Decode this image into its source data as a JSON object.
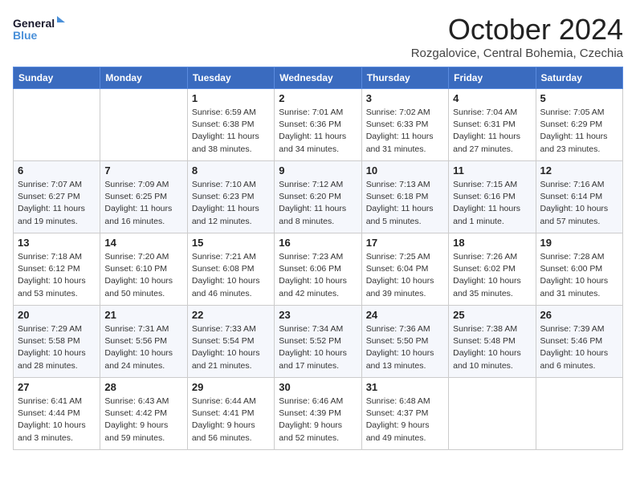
{
  "header": {
    "logo_general": "General",
    "logo_blue": "Blue",
    "month": "October 2024",
    "location": "Rozgalovice, Central Bohemia, Czechia"
  },
  "days_of_week": [
    "Sunday",
    "Monday",
    "Tuesday",
    "Wednesday",
    "Thursday",
    "Friday",
    "Saturday"
  ],
  "weeks": [
    [
      {
        "day": "",
        "info": ""
      },
      {
        "day": "",
        "info": ""
      },
      {
        "day": "1",
        "info": "Sunrise: 6:59 AM\nSunset: 6:38 PM\nDaylight: 11 hours and 38 minutes."
      },
      {
        "day": "2",
        "info": "Sunrise: 7:01 AM\nSunset: 6:36 PM\nDaylight: 11 hours and 34 minutes."
      },
      {
        "day": "3",
        "info": "Sunrise: 7:02 AM\nSunset: 6:33 PM\nDaylight: 11 hours and 31 minutes."
      },
      {
        "day": "4",
        "info": "Sunrise: 7:04 AM\nSunset: 6:31 PM\nDaylight: 11 hours and 27 minutes."
      },
      {
        "day": "5",
        "info": "Sunrise: 7:05 AM\nSunset: 6:29 PM\nDaylight: 11 hours and 23 minutes."
      }
    ],
    [
      {
        "day": "6",
        "info": "Sunrise: 7:07 AM\nSunset: 6:27 PM\nDaylight: 11 hours and 19 minutes."
      },
      {
        "day": "7",
        "info": "Sunrise: 7:09 AM\nSunset: 6:25 PM\nDaylight: 11 hours and 16 minutes."
      },
      {
        "day": "8",
        "info": "Sunrise: 7:10 AM\nSunset: 6:23 PM\nDaylight: 11 hours and 12 minutes."
      },
      {
        "day": "9",
        "info": "Sunrise: 7:12 AM\nSunset: 6:20 PM\nDaylight: 11 hours and 8 minutes."
      },
      {
        "day": "10",
        "info": "Sunrise: 7:13 AM\nSunset: 6:18 PM\nDaylight: 11 hours and 5 minutes."
      },
      {
        "day": "11",
        "info": "Sunrise: 7:15 AM\nSunset: 6:16 PM\nDaylight: 11 hours and 1 minute."
      },
      {
        "day": "12",
        "info": "Sunrise: 7:16 AM\nSunset: 6:14 PM\nDaylight: 10 hours and 57 minutes."
      }
    ],
    [
      {
        "day": "13",
        "info": "Sunrise: 7:18 AM\nSunset: 6:12 PM\nDaylight: 10 hours and 53 minutes."
      },
      {
        "day": "14",
        "info": "Sunrise: 7:20 AM\nSunset: 6:10 PM\nDaylight: 10 hours and 50 minutes."
      },
      {
        "day": "15",
        "info": "Sunrise: 7:21 AM\nSunset: 6:08 PM\nDaylight: 10 hours and 46 minutes."
      },
      {
        "day": "16",
        "info": "Sunrise: 7:23 AM\nSunset: 6:06 PM\nDaylight: 10 hours and 42 minutes."
      },
      {
        "day": "17",
        "info": "Sunrise: 7:25 AM\nSunset: 6:04 PM\nDaylight: 10 hours and 39 minutes."
      },
      {
        "day": "18",
        "info": "Sunrise: 7:26 AM\nSunset: 6:02 PM\nDaylight: 10 hours and 35 minutes."
      },
      {
        "day": "19",
        "info": "Sunrise: 7:28 AM\nSunset: 6:00 PM\nDaylight: 10 hours and 31 minutes."
      }
    ],
    [
      {
        "day": "20",
        "info": "Sunrise: 7:29 AM\nSunset: 5:58 PM\nDaylight: 10 hours and 28 minutes."
      },
      {
        "day": "21",
        "info": "Sunrise: 7:31 AM\nSunset: 5:56 PM\nDaylight: 10 hours and 24 minutes."
      },
      {
        "day": "22",
        "info": "Sunrise: 7:33 AM\nSunset: 5:54 PM\nDaylight: 10 hours and 21 minutes."
      },
      {
        "day": "23",
        "info": "Sunrise: 7:34 AM\nSunset: 5:52 PM\nDaylight: 10 hours and 17 minutes."
      },
      {
        "day": "24",
        "info": "Sunrise: 7:36 AM\nSunset: 5:50 PM\nDaylight: 10 hours and 13 minutes."
      },
      {
        "day": "25",
        "info": "Sunrise: 7:38 AM\nSunset: 5:48 PM\nDaylight: 10 hours and 10 minutes."
      },
      {
        "day": "26",
        "info": "Sunrise: 7:39 AM\nSunset: 5:46 PM\nDaylight: 10 hours and 6 minutes."
      }
    ],
    [
      {
        "day": "27",
        "info": "Sunrise: 6:41 AM\nSunset: 4:44 PM\nDaylight: 10 hours and 3 minutes."
      },
      {
        "day": "28",
        "info": "Sunrise: 6:43 AM\nSunset: 4:42 PM\nDaylight: 9 hours and 59 minutes."
      },
      {
        "day": "29",
        "info": "Sunrise: 6:44 AM\nSunset: 4:41 PM\nDaylight: 9 hours and 56 minutes."
      },
      {
        "day": "30",
        "info": "Sunrise: 6:46 AM\nSunset: 4:39 PM\nDaylight: 9 hours and 52 minutes."
      },
      {
        "day": "31",
        "info": "Sunrise: 6:48 AM\nSunset: 4:37 PM\nDaylight: 9 hours and 49 minutes."
      },
      {
        "day": "",
        "info": ""
      },
      {
        "day": "",
        "info": ""
      }
    ]
  ]
}
